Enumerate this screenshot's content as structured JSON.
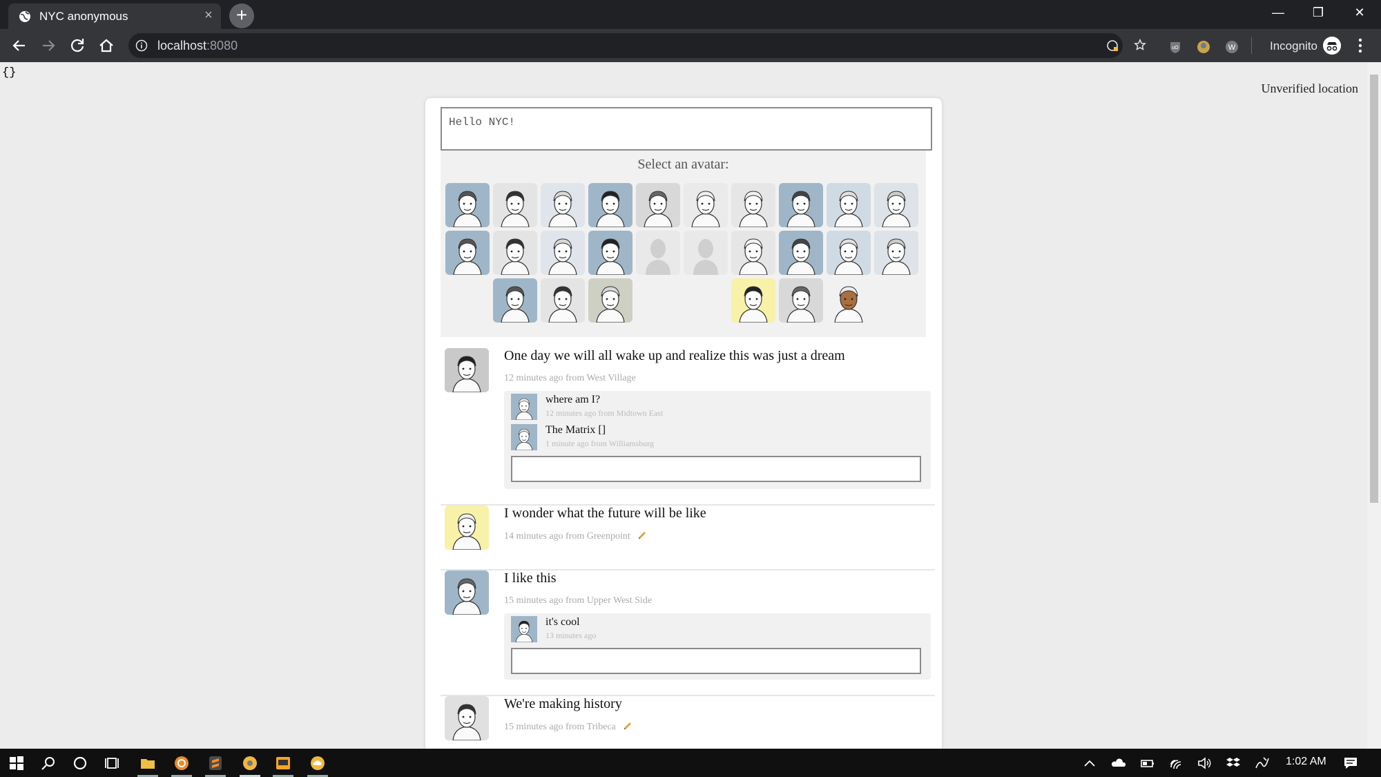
{
  "browser": {
    "tab_title": "NYC anonymous",
    "tab_close": "×",
    "new_tab": "+",
    "url_host": "localhost",
    "url_port": ":8080",
    "incognito_label": "Incognito",
    "window_controls": {
      "minimize": "—",
      "restore": "❐",
      "close": "✕"
    }
  },
  "page": {
    "raw_text": "{}",
    "location_status": "Unverified location"
  },
  "composer": {
    "value": "Hello NYC!"
  },
  "avatar_picker": {
    "heading": "Select an avatar:"
  },
  "posts": [
    {
      "text": "One day we will all wake up and realize this was just a dream",
      "meta": "12 minutes ago from West Village",
      "replies": [
        {
          "text": "where am I?",
          "meta": "12 minutes ago from Midtown East"
        },
        {
          "text": "The Matrix []",
          "meta": "1 minute ago from Williamsburg"
        }
      ]
    },
    {
      "text": "I wonder what the future will be like",
      "meta": "14 minutes ago from Greenpoint",
      "replies": []
    },
    {
      "text": "I like this",
      "meta": "15 minutes ago from Upper West Side",
      "replies": [
        {
          "text": "it's cool",
          "meta": "13 minutes ago"
        }
      ]
    },
    {
      "text": "We're making history",
      "meta": "15 minutes ago from Tribeca",
      "replies": []
    }
  ],
  "taskbar": {
    "time": "1:02 AM"
  },
  "colors": {
    "avatar_blue": "#9fb6c8",
    "avatar_yellow": "#f8f1a8",
    "avatar_gray": "#e0e0e0"
  }
}
